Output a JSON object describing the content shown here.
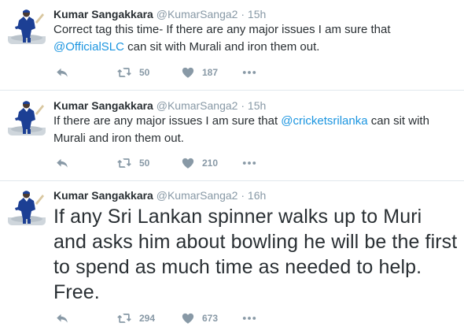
{
  "tweets": [
    {
      "name": "Kumar Sangakkara",
      "handle": "@KumarSanga2",
      "separator": "·",
      "time": "15h",
      "text_before": "Correct tag this time- If there are any major issues I am sure that ",
      "mention": "@OfficialSLC",
      "text_after": " can sit with Murali and iron them out.",
      "retweets": "50",
      "likes": "187"
    },
    {
      "name": "Kumar Sangakkara",
      "handle": "@KumarSanga2",
      "separator": "·",
      "time": "15h",
      "text_before": "If there are any major issues I am sure that ",
      "mention": "@cricketsrilanka",
      "text_after": " can sit with Murali and iron them out.",
      "retweets": "50",
      "likes": "210"
    },
    {
      "name": "Kumar Sangakkara",
      "handle": "@KumarSanga2",
      "separator": "·",
      "time": "16h",
      "text": "If any Sri Lankan spinner walks up to Muri and asks him about bowling he will be the first to spend as much time as needed to help. Free.",
      "retweets": "294",
      "likes": "673"
    }
  ],
  "colors": {
    "text": "#292f33",
    "muted": "#8899a6",
    "link": "#1b95e0",
    "divider": "#e1e8ed",
    "avatar_jersey": "#1c3f94"
  },
  "icons": [
    "reply-icon",
    "retweet-icon",
    "like-icon",
    "more-icon"
  ]
}
